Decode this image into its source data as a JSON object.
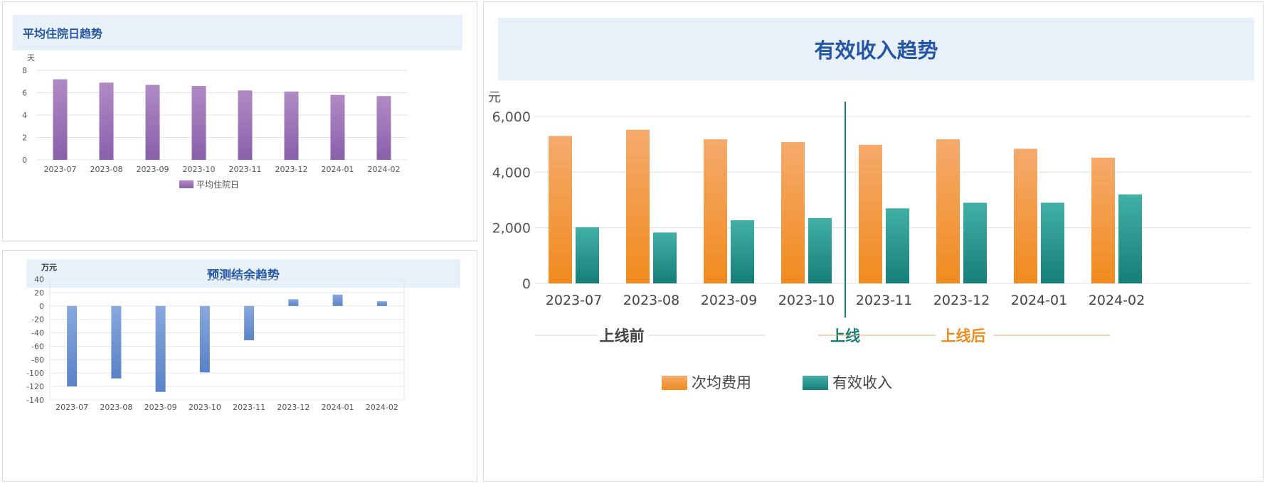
{
  "panels": {
    "los": {
      "title": "平均住院日趋势"
    },
    "balance": {
      "title": "预测结余趋势"
    },
    "income": {
      "title": "有效收入趋势"
    }
  },
  "chart_data": [
    {
      "id": "los",
      "type": "bar",
      "title": "平均住院日趋势",
      "ylabel": "天",
      "categories": [
        "2023-07",
        "2023-08",
        "2023-09",
        "2023-10",
        "2023-11",
        "2023-12",
        "2024-01",
        "2024-02"
      ],
      "series": [
        {
          "name": "平均住院日",
          "values": [
            7.2,
            6.9,
            6.7,
            6.6,
            6.2,
            6.1,
            5.8,
            5.7
          ]
        }
      ],
      "ylim": [
        0,
        8
      ],
      "yticks": [
        0,
        2,
        4,
        6,
        8
      ],
      "grid": true,
      "legend": "bottom",
      "colors": {
        "bar_top": "#b08ac4",
        "bar_bottom": "#8a5fab"
      }
    },
    {
      "id": "balance",
      "type": "bar",
      "title": "预测结余趋势",
      "ylabel": "万元",
      "categories": [
        "2023-07",
        "2023-08",
        "2023-09",
        "2023-10",
        "2023-11",
        "2023-12",
        "2024-01",
        "2024-02"
      ],
      "values": [
        -120,
        -108,
        -128,
        -99,
        -51,
        10,
        17,
        7
      ],
      "ylim": [
        -140,
        40
      ],
      "yticks": [
        -140,
        -120,
        -100,
        -80,
        -60,
        -40,
        -20,
        0,
        20,
        40
      ],
      "grid": true,
      "colors": {
        "bar_top": "#88a8de",
        "bar_bottom": "#5a82c8"
      }
    },
    {
      "id": "income",
      "type": "bar",
      "title": "有效收入趋势",
      "ylabel": "元",
      "categories": [
        "2023-07",
        "2023-08",
        "2023-09",
        "2023-10",
        "2023-11",
        "2023-12",
        "2024-01",
        "2024-02"
      ],
      "series": [
        {
          "name": "次均费用",
          "values": [
            5300,
            5520,
            5180,
            5080,
            4980,
            5180,
            4840,
            4520
          ]
        },
        {
          "name": "有效收入",
          "values": [
            2020,
            1830,
            2270,
            2350,
            2700,
            2900,
            2900,
            3200
          ]
        }
      ],
      "ylim": [
        0,
        6000
      ],
      "yticks": [
        0,
        2000,
        4000,
        6000
      ],
      "ytick_labels": [
        "0",
        "2,000",
        "4,000",
        "6,000"
      ],
      "grid": true,
      "legend": "bottom",
      "colors": {
        "fee_top": "#f5aa6c",
        "fee_bottom": "#f08b1e",
        "income_top": "#42b0a6",
        "income_bottom": "#167e78",
        "divider": "#168077"
      },
      "phases": {
        "before": "上线前",
        "launch": "上线",
        "after": "上线后"
      }
    }
  ]
}
